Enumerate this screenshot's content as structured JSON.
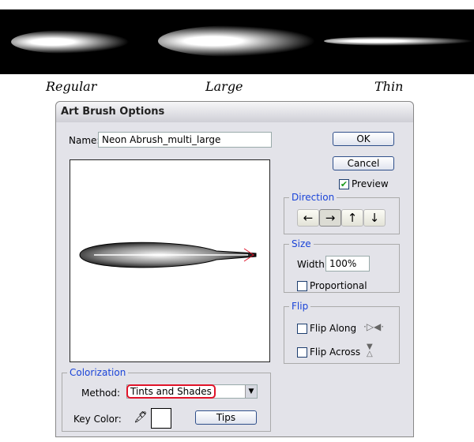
{
  "samples": [
    {
      "label": "Regular"
    },
    {
      "label": "Large"
    },
    {
      "label": "Thin"
    }
  ],
  "dialog": {
    "title": "Art Brush Options",
    "name_label": "Name:",
    "name_value": "Neon Abrush_multi_large",
    "ok": "OK",
    "cancel": "Cancel",
    "preview": {
      "label": "Preview",
      "checked": true
    },
    "direction": {
      "legend": "Direction",
      "buttons": [
        "←",
        "→",
        "↑",
        "↓"
      ],
      "selected": "→"
    },
    "size": {
      "legend": "Size",
      "width_label": "Width:",
      "width_value": "100%",
      "proportional_label": "Proportional",
      "proportional_checked": false
    },
    "flip": {
      "legend": "Flip",
      "along_label": "Flip Along",
      "across_label": "Flip Across"
    },
    "colorization": {
      "legend": "Colorization",
      "method_label": "Method:",
      "method_value": "Tints and Shades",
      "key_color_label": "Key Color:",
      "key_color": "#ffffff",
      "tips": "Tips"
    },
    "highlight_color": "#e0142a"
  }
}
